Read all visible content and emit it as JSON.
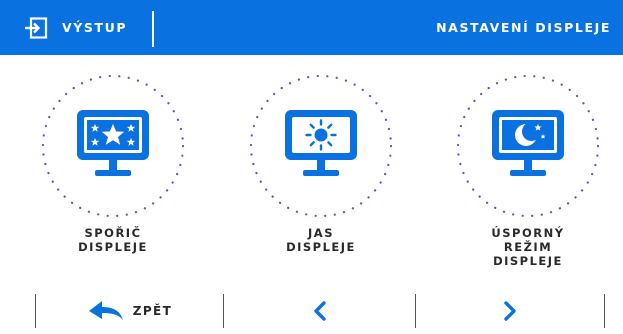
{
  "header": {
    "exit_label": "VÝSTUP",
    "title": "NASTAVENÍ DISPLEJE"
  },
  "tiles": [
    {
      "label_lines": [
        "SPOŘIČ",
        "DISPLEJE"
      ],
      "icon": "screensaver-stars-icon"
    },
    {
      "label_lines": [
        "JAS",
        "DISPLEJE"
      ],
      "icon": "brightness-sun-icon"
    },
    {
      "label_lines": [
        "ÚSPORNÝ",
        "REŽIM",
        "DISPLEJE"
      ],
      "icon": "night-mode-moon-icon"
    }
  ],
  "footer": {
    "back_label": "ZPĚT",
    "prev_icon": "chevron-left-icon",
    "next_icon": "chevron-right-icon"
  },
  "colors": {
    "accent": "#0a72e0",
    "ring_dots": "#6b4fb8",
    "text": "#2a2a2a"
  }
}
